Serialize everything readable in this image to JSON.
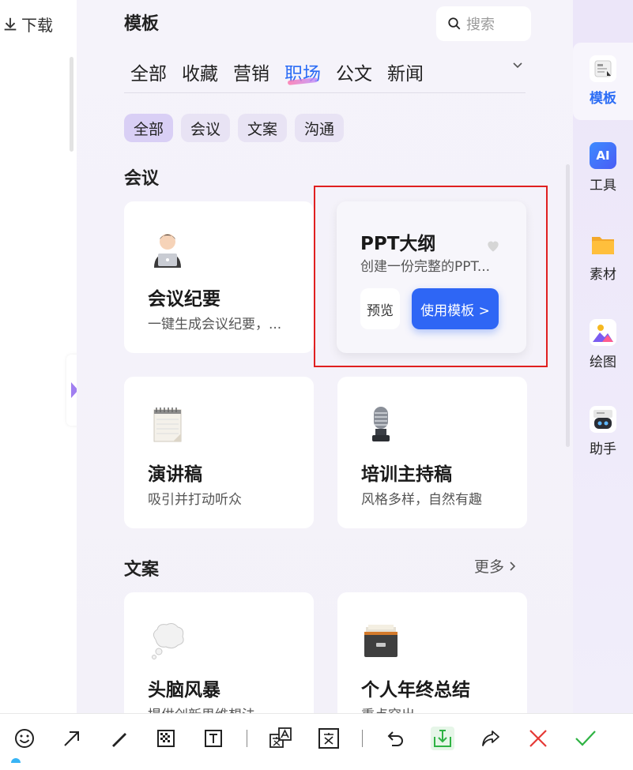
{
  "left": {
    "download_label": "下载"
  },
  "panel": {
    "title": "模板",
    "search_placeholder": "搜索",
    "tabs": [
      "全部",
      "收藏",
      "营销",
      "职场",
      "公文",
      "新闻"
    ],
    "active_tab": "职场",
    "chips": [
      "全部",
      "会议",
      "文案",
      "沟通"
    ]
  },
  "sections": {
    "meeting": {
      "title": "会议",
      "cards": [
        {
          "title": "会议纪要",
          "desc": "一键生成会议纪要，...",
          "icon": "person-laptop-emoji"
        },
        {
          "title": "PPT大纲",
          "desc": "创建一份完整的PPT...",
          "preview": "预览",
          "use": "使用模板 >"
        },
        {
          "title": "演讲稿",
          "desc": "吸引并打动听众",
          "icon": "notepad-emoji"
        },
        {
          "title": "培训主持稿",
          "desc": "风格多样，自然有趣",
          "icon": "microphone-emoji"
        }
      ]
    },
    "copywriting": {
      "title": "文案",
      "more": "更多",
      "cards": [
        {
          "title": "头脑风暴",
          "desc": "提供创新思维想法",
          "icon": "thought-bubble-emoji"
        },
        {
          "title": "个人年终总结",
          "desc": "重点突出",
          "icon": "file-cabinet-emoji"
        }
      ]
    }
  },
  "rightbar": {
    "items": [
      {
        "label": "模板",
        "icon": "template-icon"
      },
      {
        "label": "工具",
        "icon": "ai-icon",
        "badge": "AI"
      },
      {
        "label": "素材",
        "icon": "folder-icon"
      },
      {
        "label": "绘图",
        "icon": "image-icon"
      },
      {
        "label": "助手",
        "icon": "robot-icon"
      }
    ]
  },
  "colors": {
    "accent": "#2c6df5",
    "close": "#e53935",
    "confirm": "#2fb344"
  }
}
